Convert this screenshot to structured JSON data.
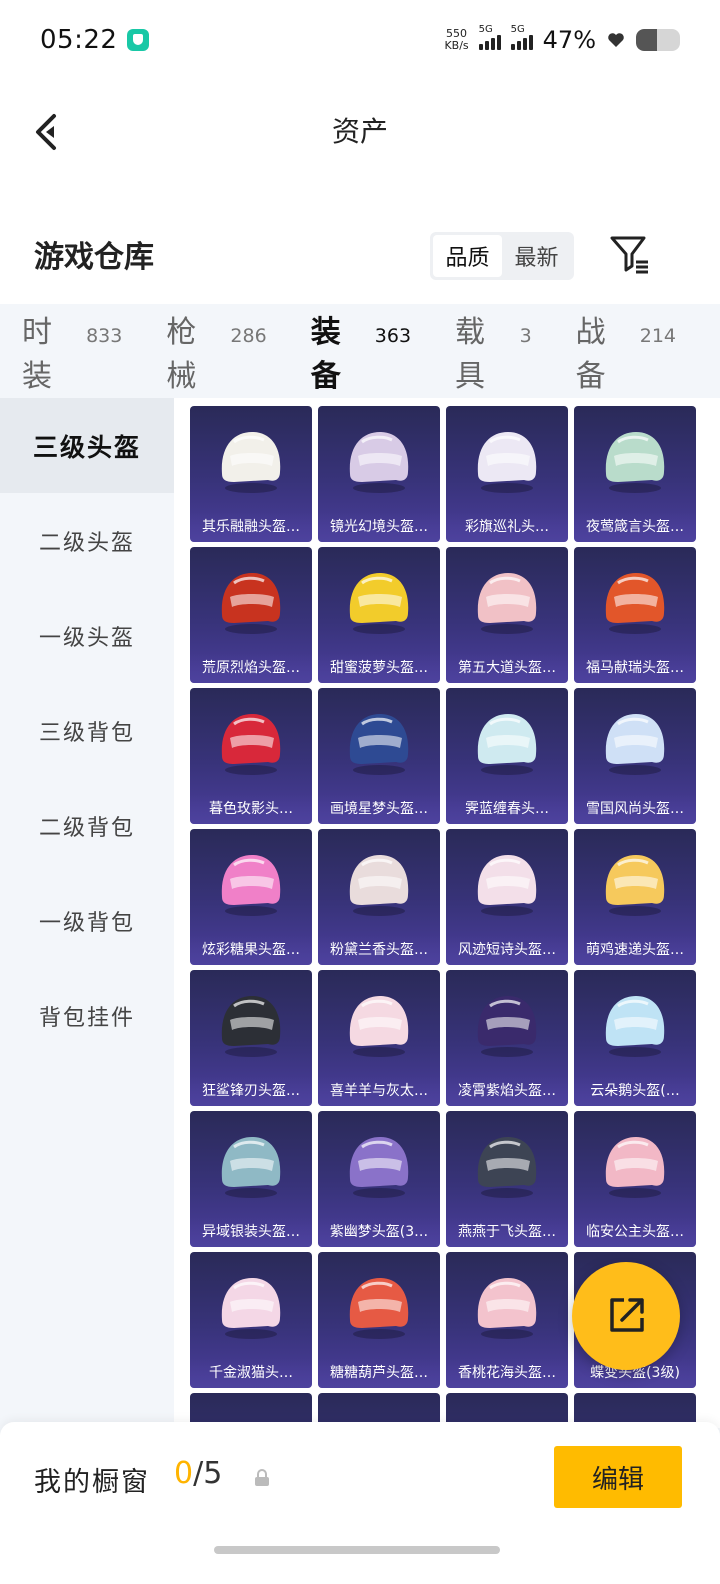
{
  "status_bar": {
    "time": "05:22",
    "net_speed_value": "550",
    "net_speed_unit": "KB/s",
    "sim1_label": "5G",
    "sim2_label": "5G",
    "battery_percent": "47%",
    "battery_level": 0.47
  },
  "header": {
    "title": "资产",
    "back_icon": "chevron-left-icon"
  },
  "warehouse": {
    "title": "游戏仓库",
    "sort_options": [
      "品质",
      "最新"
    ],
    "active_sort": "品质",
    "filter_icon": "filter-icon"
  },
  "tabs": [
    {
      "name": "时装",
      "count": "833"
    },
    {
      "name": "枪械",
      "count": "286"
    },
    {
      "name": "装备",
      "count": "363",
      "active": true
    },
    {
      "name": "载具",
      "count": "3"
    },
    {
      "name": "战备",
      "count": "214"
    }
  ],
  "sidebar": {
    "items": [
      "三级头盔",
      "二级头盔",
      "一级头盔",
      "三级背包",
      "二级背包",
      "一级背包",
      "背包挂件"
    ],
    "active": "三级头盔"
  },
  "items": [
    {
      "label": "其乐融融头盔…",
      "color": "#f2f0ea"
    },
    {
      "label": "镜光幻境头盔…",
      "color": "#d8cbe6"
    },
    {
      "label": "彩旗巡礼头…",
      "color": "#ece8f4"
    },
    {
      "label": "夜莺箴言头盔…",
      "color": "#b9dccb"
    },
    {
      "label": "荒原烈焰头盔…",
      "color": "#c8331f"
    },
    {
      "label": "甜蜜菠萝头盔…",
      "color": "#f2cc2b"
    },
    {
      "label": "第五大道头盔…",
      "color": "#f1c1c6"
    },
    {
      "label": "福马献瑞头盔…",
      "color": "#e2562a"
    },
    {
      "label": "暮色玫影头…",
      "color": "#d8283a"
    },
    {
      "label": "画境星梦头盔…",
      "color": "#2e4a93"
    },
    {
      "label": "霁蓝缠春头…",
      "color": "#cfeaf0"
    },
    {
      "label": "雪国风尚头盔…",
      "color": "#cfe0f6"
    },
    {
      "label": "炫彩糖果头盔…",
      "color": "#f080c8"
    },
    {
      "label": "粉黛兰香头盔…",
      "color": "#e9dcdc"
    },
    {
      "label": "风迹短诗头盔…",
      "color": "#f3dfe9"
    },
    {
      "label": "萌鸡速递头盔…",
      "color": "#f6c95c"
    },
    {
      "label": "狂鲨锋刃头盔…",
      "color": "#2c2f36"
    },
    {
      "label": "喜羊羊与灰太…",
      "color": "#f5d9e2"
    },
    {
      "label": "凌霄紫焰头盔…",
      "color": "#3a2a6c"
    },
    {
      "label": "云朵鹅头盔(…",
      "color": "#bfe3f5"
    },
    {
      "label": "异域银装头盔…",
      "color": "#8fb9c5"
    },
    {
      "label": "紫幽梦头盔(3…",
      "color": "#8a72c9"
    },
    {
      "label": "燕燕于飞头盔…",
      "color": "#3d4454"
    },
    {
      "label": "临安公主头盔…",
      "color": "#f2b8c6"
    },
    {
      "label": "千金淑猫头…",
      "color": "#f4d7e6"
    },
    {
      "label": "糖糖葫芦头盔…",
      "color": "#e65a44"
    },
    {
      "label": "香桃花海头盔…",
      "color": "#f3c3cd"
    },
    {
      "label": "蝶变头盔(3级)",
      "color": "#c9a8e8"
    }
  ],
  "fab": {
    "icon": "external-share-icon"
  },
  "bottom": {
    "showcase_label": "我的橱窗",
    "showcase_current": "0",
    "showcase_separator": "/",
    "showcase_total": "5",
    "lock_icon": "lock-icon",
    "edit_label": "编辑"
  },
  "colors": {
    "accent": "#ffbb00",
    "card_top": "#2a2a58",
    "card_bottom": "#4a3d9b"
  }
}
